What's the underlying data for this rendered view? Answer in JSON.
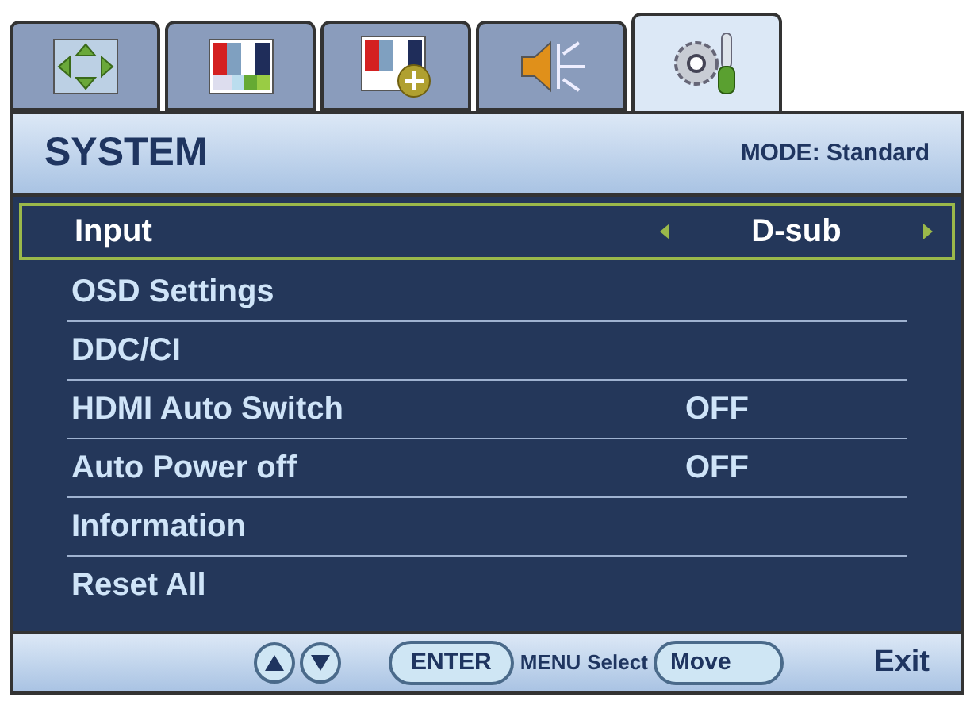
{
  "tabs": [
    {
      "kind": "display",
      "selected": false
    },
    {
      "kind": "picture",
      "selected": false
    },
    {
      "kind": "picture_advanced",
      "selected": false
    },
    {
      "kind": "audio",
      "selected": false
    },
    {
      "kind": "system",
      "selected": true
    }
  ],
  "header": {
    "title": "SYSTEM",
    "mode": "MODE: Standard"
  },
  "items": [
    {
      "label": "Input",
      "value": "D-sub",
      "selected": true
    },
    {
      "label": "OSD Settings",
      "selected": false
    },
    {
      "label": "DDC/CI",
      "selected": false
    },
    {
      "label": "HDMI Auto Switch",
      "value": "OFF",
      "selected": false
    },
    {
      "label": "Auto Power off",
      "value": "OFF",
      "selected": false
    },
    {
      "label": "Information",
      "selected": false
    },
    {
      "label": "Reset All",
      "selected": false
    }
  ],
  "footer": {
    "enter": "ENTER",
    "menu": "MENU",
    "select": "Select",
    "move": "Move",
    "exit": "Exit"
  }
}
